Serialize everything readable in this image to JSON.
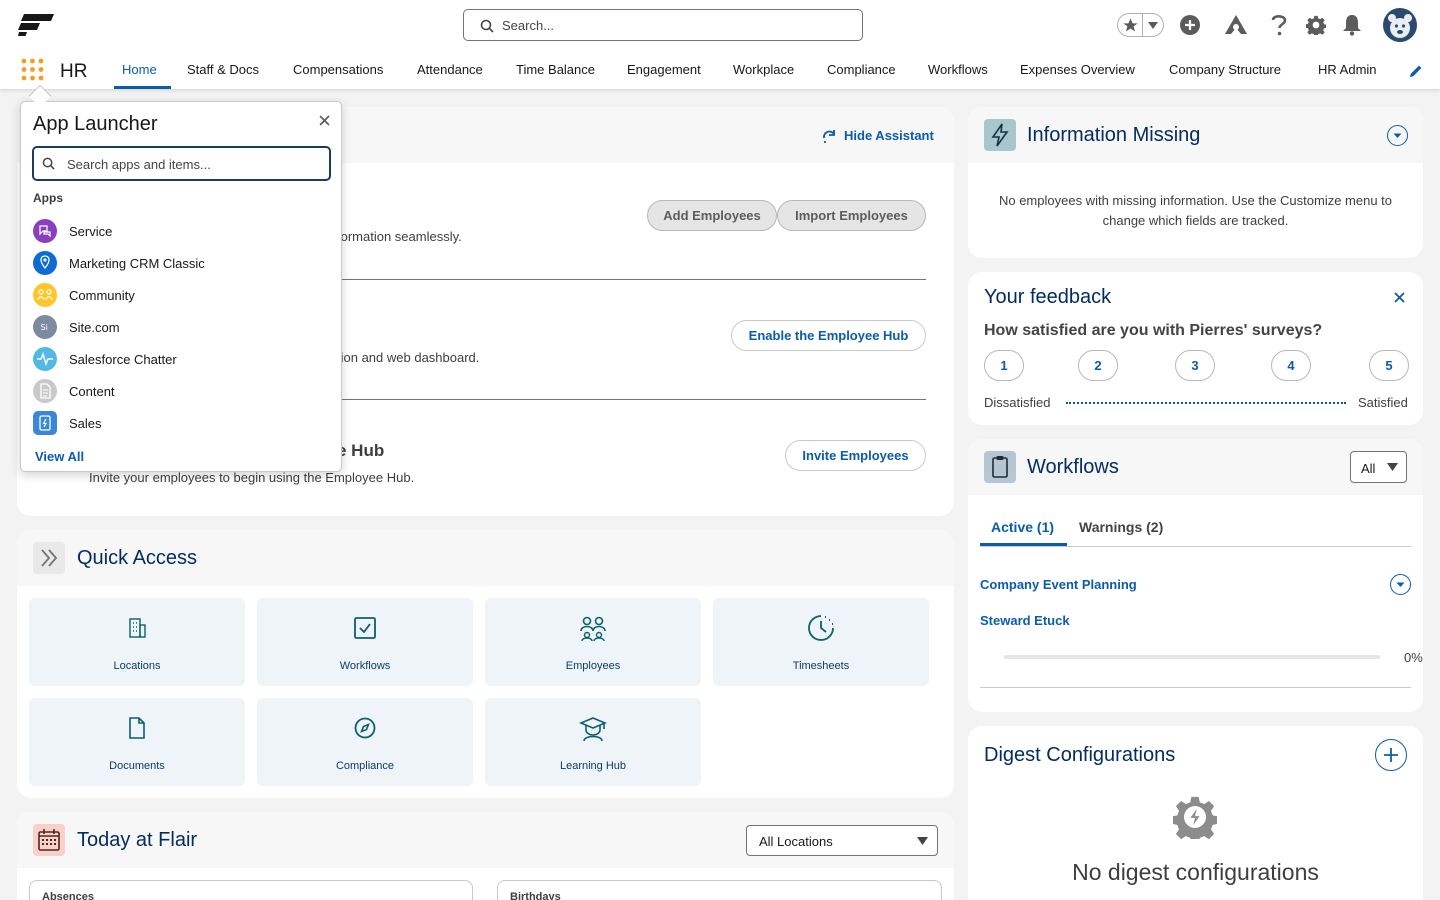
{
  "header": {
    "search_placeholder": "Search...",
    "app_name": "HR"
  },
  "nav": {
    "tabs": [
      {
        "label": "Home",
        "active": true
      },
      {
        "label": "Staff & Docs"
      },
      {
        "label": "Compensations"
      },
      {
        "label": "Attendance"
      },
      {
        "label": "Time Balance"
      },
      {
        "label": "Engagement"
      },
      {
        "label": "Workplace"
      },
      {
        "label": "Compliance"
      },
      {
        "label": "Workflows"
      },
      {
        "label": "Expenses Overview"
      },
      {
        "label": "Company Structure"
      },
      {
        "label": "HR Admin"
      }
    ]
  },
  "assistant": {
    "hide_label": "Hide Assistant",
    "add_employees": "Add Employees",
    "import_employees": "Import Employees",
    "step1_text": "formation seamlessly.",
    "enable_hub": "Enable the Employee Hub",
    "step2_text": "tion and web dashboard.",
    "step3_title": "e Hub",
    "step3_text": "Invite your employees to begin using the Employee Hub.",
    "invite_employees": "Invite Employees"
  },
  "launcher": {
    "title": "App Launcher",
    "search_placeholder": "Search apps and items...",
    "apps_heading": "Apps",
    "apps": [
      {
        "name": "Service",
        "color": "#8a3fbf"
      },
      {
        "name": "Marketing CRM Classic",
        "color": "#0b6cd4"
      },
      {
        "name": "Community",
        "color": "#ffc629"
      },
      {
        "name": "Site.com",
        "color": "#7d8ba0"
      },
      {
        "name": "Salesforce Chatter",
        "color": "#53b8e6"
      },
      {
        "name": "Content",
        "color": "#c9c9c9"
      },
      {
        "name": "Sales",
        "color": "#3a86d8"
      }
    ],
    "view_all": "View All"
  },
  "quick_access": {
    "title": "Quick Access",
    "tiles": [
      {
        "label": "Locations",
        "icon": "building-icon"
      },
      {
        "label": "Workflows",
        "icon": "checkbox-icon"
      },
      {
        "label": "Employees",
        "icon": "people-icon"
      },
      {
        "label": "Timesheets",
        "icon": "clock-icon"
      },
      {
        "label": "Documents",
        "icon": "document-icon"
      },
      {
        "label": "Compliance",
        "icon": "compass-icon"
      },
      {
        "label": "Learning Hub",
        "icon": "graduation-icon"
      }
    ]
  },
  "today": {
    "title": "Today at Flair",
    "location_select": "All Locations",
    "absences_label": "Absences",
    "birthdays_label": "Birthdays"
  },
  "info_missing": {
    "title": "Information Missing",
    "text_line1": "No employees with missing information. Use the Customize menu to",
    "text_line2": "change which fields are tracked."
  },
  "feedback": {
    "title": "Your feedback",
    "question": "How satisfied are you with Pierres' surveys?",
    "ratings": [
      "1",
      "2",
      "3",
      "4",
      "5"
    ],
    "low_label": "Dissatisfied",
    "high_label": "Satisfied"
  },
  "workflows": {
    "title": "Workflows",
    "filter": "All",
    "tab_active": "Active (1)",
    "tab_warnings": "Warnings (2)",
    "item_title": "Company Event Planning",
    "item_sub": "Steward Etuck",
    "progress_label": "0%",
    "progress": 0
  },
  "digest": {
    "title": "Digest Configurations",
    "empty_text": "No digest configurations"
  },
  "colors": {
    "brand_blue": "#0b5cab",
    "dark_navy": "#032d60",
    "teal": "#0b5f70"
  }
}
